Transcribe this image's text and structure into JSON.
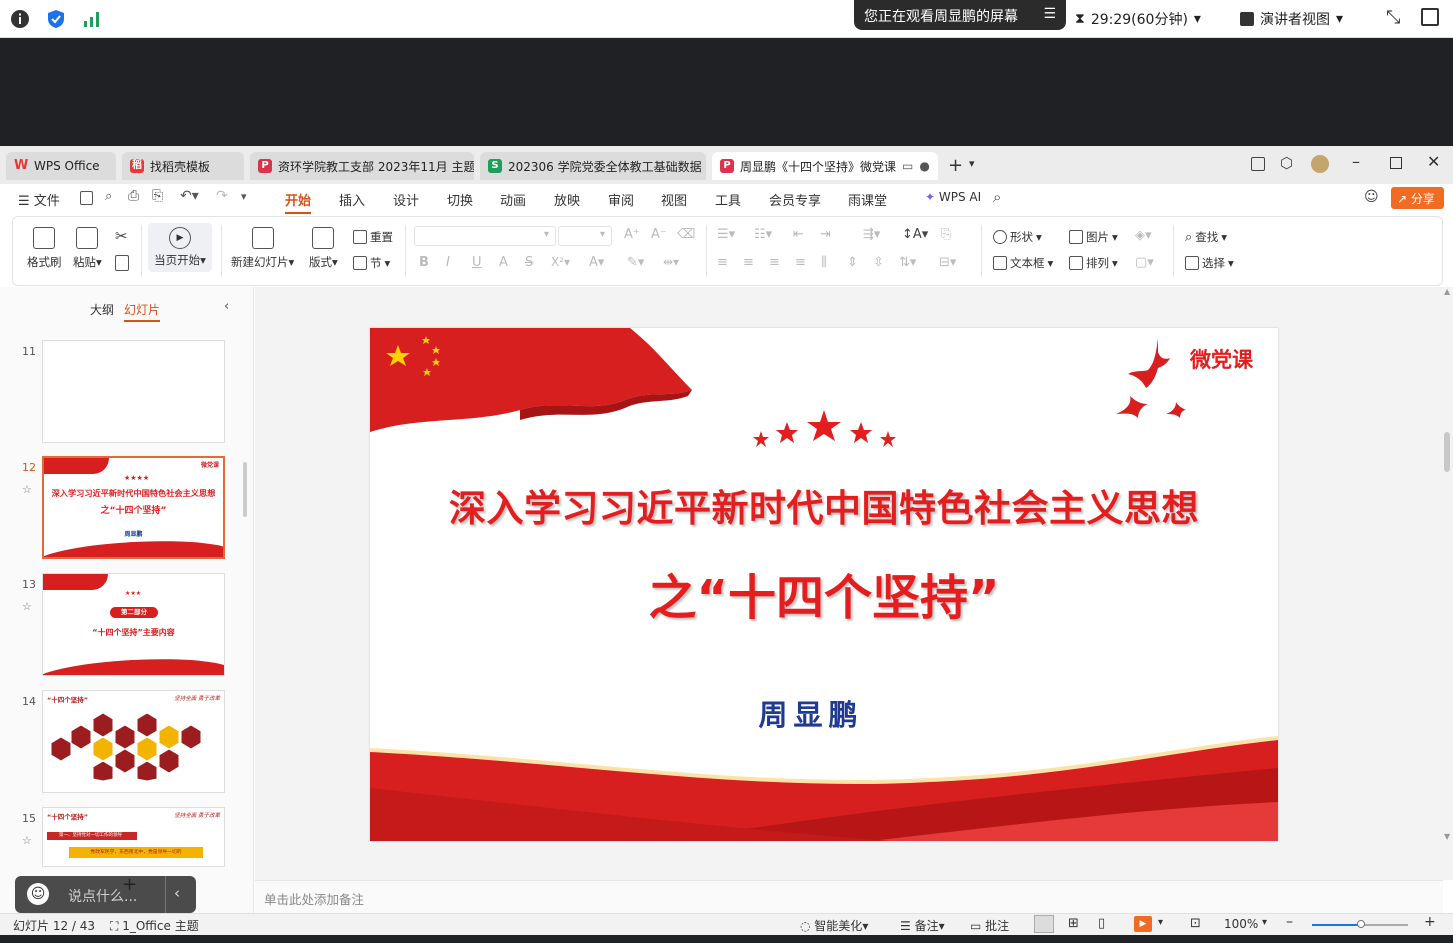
{
  "meeting": {
    "share_text": "您正在观看周显鹏的屏幕",
    "timer": "29:29(60分钟)",
    "presenter_view": "演讲者视图"
  },
  "tabs": [
    {
      "label": "WPS Office",
      "color": "#e53935",
      "icon": "W"
    },
    {
      "label": "找稻壳模板",
      "color": "#e53935",
      "icon": "稻"
    },
    {
      "label": "资环学院教工支部 2023年11月 主题党",
      "color": "#d9344a",
      "icon": "P"
    },
    {
      "label": "202306 学院党委全体教工基础数据",
      "color": "#1e9e5a",
      "icon": "S"
    },
    {
      "label": "周显鹏《十四个坚持》微党课",
      "color": "#d9344a",
      "icon": "P"
    }
  ],
  "menu": {
    "file": "文件",
    "items": [
      "开始",
      "插入",
      "设计",
      "切换",
      "动画",
      "放映",
      "审阅",
      "视图",
      "工具",
      "会员专享",
      "雨课堂"
    ],
    "wps_ai": "WPS AI",
    "share": "分享"
  },
  "ribbon": {
    "format_painter": "格式刷",
    "paste": "粘贴",
    "from_current": "当页开始",
    "new_slide": "新建幻灯片",
    "layout": "版式",
    "reset": "重置",
    "section": "节",
    "shape": "形状",
    "picture": "图片",
    "textbox": "文本框",
    "arrange": "排列",
    "find": "查找",
    "select": "选择"
  },
  "panel": {
    "outline_tab": "大纲",
    "slides_tab": "幻灯片"
  },
  "thumbnails": [
    {
      "num": "11"
    },
    {
      "num": "12",
      "title": "深入学习习近平新时代中国特色社会主义思想",
      "subtitle": "之“十四个坚持”",
      "author": "周显鹏",
      "badge": "微党课"
    },
    {
      "num": "13",
      "part": "第二部分",
      "subtitle": "“十四个坚持”主要内容"
    },
    {
      "num": "14",
      "heading": "“十四个坚持”",
      "tagline": "坚持全面  勇于改革"
    },
    {
      "num": "15",
      "heading": "“十四个坚持”",
      "tagline": "坚持全面  勇于改革",
      "line1": "第一、坚持党对一切工作的领导",
      "line2": "党政军民学，东西南北中，党是领导一切的"
    }
  ],
  "slide": {
    "badge": "微党课",
    "title_line1": "深入学习习近平新时代中国特色社会主义思想",
    "title_line2": "之“十四个坚持”",
    "author": "周显鹏"
  },
  "notes_placeholder": "单击此处添加备注",
  "chat_placeholder": "说点什么...",
  "status": {
    "slide_count": "幻灯片 12 / 43",
    "theme": "1_Office 主题",
    "beautify": "智能美化",
    "notes": "备注",
    "comments": "批注",
    "zoom": "100%"
  },
  "colors": {
    "accent": "#d4521b",
    "slide_red": "#e41e1e",
    "author_blue": "#1f3a93"
  }
}
